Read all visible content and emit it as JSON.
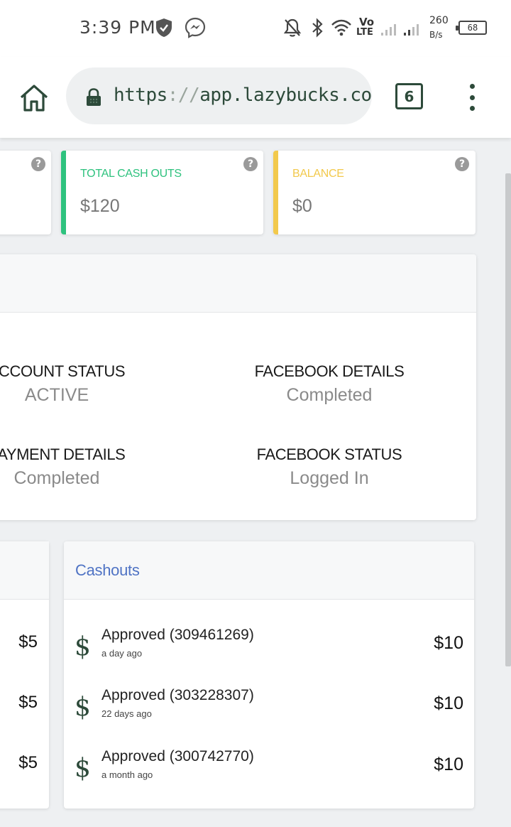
{
  "status_bar": {
    "time": "3:39 PM",
    "net_speed_value": "260",
    "net_speed_unit": "B/s",
    "volte_top": "Vo",
    "volte_bottom": "LTE",
    "battery": "68",
    "icons": [
      "shield-icon",
      "messenger-icon",
      "notifications-off-icon",
      "bluetooth-icon",
      "wifi-icon",
      "signal-icon",
      "battery-icon"
    ]
  },
  "browser": {
    "url_scheme": "https",
    "url_sep": "://",
    "url_host": "app.lazybucks.co",
    "tab_count": "6",
    "accent": "#2d4a3a"
  },
  "stats": [
    {
      "label": "TOTAL CASH OUTS",
      "value": "$120",
      "color": "#2ec27e"
    },
    {
      "label": "BALANCE",
      "value": "$0",
      "color": "#f2c94c"
    }
  ],
  "account": {
    "items": [
      {
        "title": "ACCOUNT STATUS",
        "value": "ACTIVE"
      },
      {
        "title": "FACEBOOK DETAILS",
        "value": "Completed"
      },
      {
        "title": "PAYMENT DETAILS",
        "value": "Completed"
      },
      {
        "title": "FACEBOOK STATUS",
        "value": "Logged In"
      }
    ]
  },
  "left_panel": {
    "amounts": [
      "$5",
      "$5",
      "$5"
    ]
  },
  "cashouts": {
    "title": "Cashouts",
    "rows": [
      {
        "icon": "$",
        "status": "Approved (309461269)",
        "when": "a day ago",
        "amount": "$10"
      },
      {
        "icon": "$",
        "status": "Approved (303228307)",
        "when": "22 days ago",
        "amount": "$10"
      },
      {
        "icon": "$",
        "status": "Approved (300742770)",
        "when": "a month ago",
        "amount": "$10"
      }
    ]
  }
}
